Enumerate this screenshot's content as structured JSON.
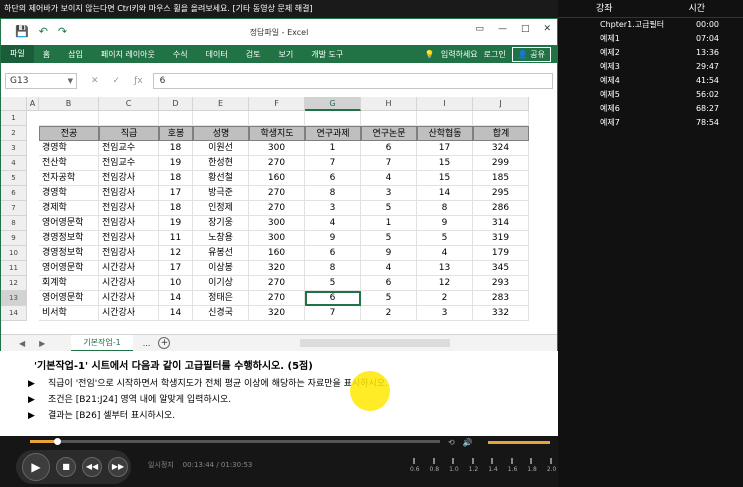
{
  "topbar": {
    "text": "하단의 제어바가 보이지 않는다면 Ctrl키와 마우스 휠을 올려보세요. [기타 동영상 문제 해결]"
  },
  "excel": {
    "title": "정답파일 - Excel",
    "tabs": [
      "파일",
      "홈",
      "삽입",
      "페이지 레이아웃",
      "수식",
      "데이터",
      "검토",
      "보기",
      "개발 도구"
    ],
    "search": "입력하세요",
    "login": "로그인",
    "share": "공유",
    "namebox": "G13",
    "formula": "6",
    "columns": [
      "A",
      "B",
      "C",
      "D",
      "E",
      "F",
      "G",
      "H",
      "I",
      "J"
    ],
    "header_row": [
      "전공",
      "직급",
      "호봉",
      "성명",
      "학생지도",
      "연구과제",
      "연구논문",
      "산학협동",
      "합계"
    ],
    "rows": [
      {
        "n": "1",
        "cells": [
          "",
          "",
          "",
          "",
          "",
          "",
          "",
          "",
          ""
        ]
      },
      {
        "n": "3",
        "cells": [
          "경영학",
          "전임교수",
          "18",
          "이원선",
          "300",
          "1",
          "6",
          "17",
          "324"
        ]
      },
      {
        "n": "4",
        "cells": [
          "전산학",
          "전임교수",
          "19",
          "한성현",
          "270",
          "7",
          "7",
          "15",
          "299"
        ]
      },
      {
        "n": "5",
        "cells": [
          "전자공학",
          "전임강사",
          "18",
          "황선철",
          "160",
          "6",
          "4",
          "15",
          "185"
        ]
      },
      {
        "n": "6",
        "cells": [
          "경영학",
          "전임강사",
          "17",
          "방극준",
          "270",
          "8",
          "3",
          "14",
          "295"
        ]
      },
      {
        "n": "7",
        "cells": [
          "경제학",
          "전임강사",
          "18",
          "인정제",
          "270",
          "3",
          "5",
          "8",
          "286"
        ]
      },
      {
        "n": "8",
        "cells": [
          "영어영문학",
          "전임강사",
          "19",
          "장기웅",
          "300",
          "4",
          "1",
          "9",
          "314"
        ]
      },
      {
        "n": "9",
        "cells": [
          "경영정보학",
          "전임강사",
          "11",
          "노창용",
          "300",
          "9",
          "5",
          "5",
          "319"
        ]
      },
      {
        "n": "10",
        "cells": [
          "경영정보학",
          "전임강사",
          "12",
          "유봉선",
          "160",
          "6",
          "9",
          "4",
          "179"
        ]
      },
      {
        "n": "11",
        "cells": [
          "영어영문학",
          "시간강사",
          "17",
          "이상봉",
          "320",
          "8",
          "4",
          "13",
          "345"
        ]
      },
      {
        "n": "12",
        "cells": [
          "회계학",
          "시간강사",
          "10",
          "이기상",
          "270",
          "5",
          "6",
          "12",
          "293"
        ]
      },
      {
        "n": "13",
        "cells": [
          "영어영문학",
          "시간강사",
          "14",
          "정태은",
          "270",
          "6",
          "5",
          "2",
          "283"
        ]
      },
      {
        "n": "14",
        "cells": [
          "비서학",
          "시간강사",
          "14",
          "신경국",
          "320",
          "7",
          "2",
          "3",
          "332"
        ]
      }
    ],
    "sheet_tab": "기본작업-1",
    "more": "...",
    "add": "+"
  },
  "instructions": {
    "question": "'기본작업-1' 시트에서 다음과 같이 고급필터를 수행하시오. (5점)",
    "bullets": [
      "직급이 '전임'으로 시작하면서 학생지도가 전체 평균 이상에 해당하는 자료만을 표시하시오.",
      "조건은 [B21:J24] 영역 내에 알맞게 입력하시오.",
      "결과는 [B26] 셀부터 표시하시오."
    ]
  },
  "player": {
    "progress": 0.063,
    "status": "일시정지",
    "time": "00:13:44 / 01:30:53",
    "speeds": [
      "0.6",
      "0.8",
      "1.0",
      "1.2",
      "1.4",
      "1.6",
      "1.8",
      "2.0"
    ]
  },
  "chapters": {
    "col_title": "강좌",
    "col_time": "시간",
    "items": [
      {
        "name": "Chpter1.고급필터",
        "time": "00:00"
      },
      {
        "name": "예제1",
        "time": "07:04"
      },
      {
        "name": "예제2",
        "time": "13:36"
      },
      {
        "name": "예제3",
        "time": "29:47"
      },
      {
        "name": "예제4",
        "time": "41:54"
      },
      {
        "name": "예제5",
        "time": "56:02"
      },
      {
        "name": "예제6",
        "time": "68:27"
      },
      {
        "name": "예제7",
        "time": "78:54"
      }
    ]
  }
}
